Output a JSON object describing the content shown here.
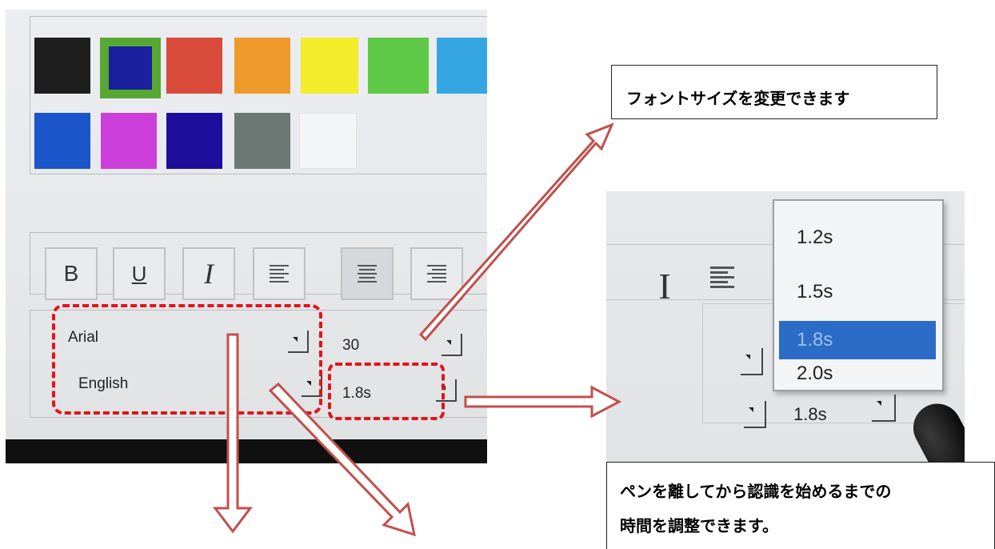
{
  "palette": {
    "colors": [
      "#1e1e1e",
      "#1a1f9e",
      "#d84a3a",
      "#ee9a2a",
      "#f2ec2a",
      "#5ec947",
      "#36a6e3",
      "#1a55c9",
      "#cc3ed9",
      "#1f0d9c",
      "#6b7873",
      "#f3f4f5"
    ],
    "selected_index": 1,
    "selected_border_color": "#57a833"
  },
  "toolbar": {
    "bold_label": "B",
    "underline_label": "U",
    "italic_label": "I"
  },
  "settings": {
    "font_value": "Arial",
    "language_value": "English",
    "font_size_value": "30",
    "delay_value": "1.8s"
  },
  "zoom": {
    "italic_label": "I",
    "options": [
      "1.2s",
      "1.5s",
      "1.8s",
      "2.0s"
    ],
    "selected_index": 2,
    "delay_value": "1.8s"
  },
  "callouts": {
    "font_size_note": "フォントサイズを変更できます",
    "delay_note_line1": "ペンを離してから認識を始めるまでの",
    "delay_note_line2": "時間を調整できます。"
  },
  "colors": {
    "highlight_dash": "#e0141b",
    "arrow_stroke": "#c0504d",
    "dropdown_selected": "#2b6cc7"
  }
}
